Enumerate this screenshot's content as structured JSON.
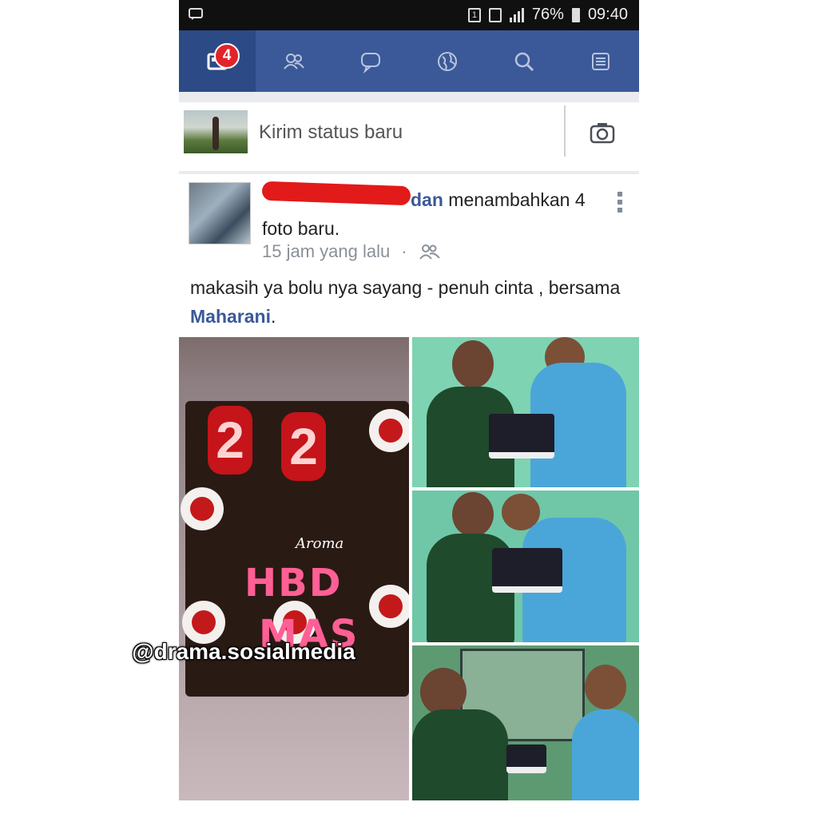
{
  "status_bar": {
    "signal_1": "1",
    "battery_percent": "76%",
    "time": "09:40"
  },
  "nav": {
    "tabs": [
      "news-feed",
      "friend-requests",
      "messages",
      "notifications",
      "search",
      "more"
    ],
    "news_feed_badge": "4",
    "colors": {
      "bar": "#3b5998",
      "active": "#2c4a86",
      "badge": "#e0242a"
    }
  },
  "composer": {
    "placeholder": "Kirim status baru"
  },
  "post": {
    "author_tail": "dan",
    "action": " menambahkan 4 foto baru.",
    "time": "15 jam yang lalu",
    "separator": "·",
    "caption_part1": "makasih ya bolu nya sayang - penuh cinta , bersama ",
    "mention": "Maharani",
    "caption_end": ".",
    "photos": {
      "cake_candles": [
        "2",
        "2"
      ],
      "cake_brand": "Aroma",
      "cake_writing_line1": "HBD",
      "cake_writing_line2": "MAS"
    }
  },
  "watermark": "@drama.sosialmedia"
}
